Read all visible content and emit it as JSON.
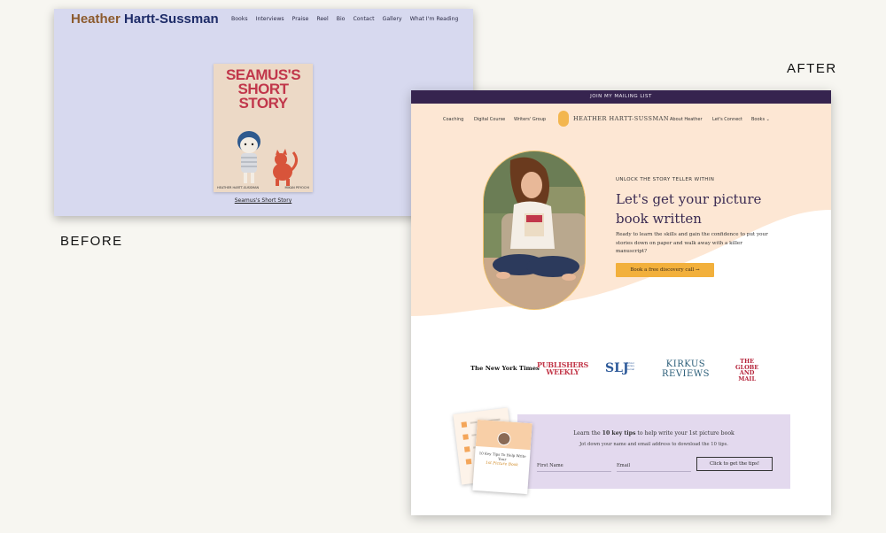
{
  "labels": {
    "before": "BEFORE",
    "after": "AFTER"
  },
  "before": {
    "logo_first": "Heather",
    "logo_last": "Hartt-Sussman",
    "nav": [
      "Books",
      "Interviews",
      "Praise",
      "Reel",
      "Bio",
      "Contact",
      "Gallery",
      "What I'm Reading"
    ],
    "book_title": "SEAMUS'S SHORT STORY",
    "book_authors": [
      "HEATHER HARTT-SUSSMAN",
      "MIKAN PEYOCHI"
    ],
    "caption": "Seamus's Short Story"
  },
  "after": {
    "topbar": "JOIN MY MAILING LIST",
    "nav_left": [
      "Coaching",
      "Digital Course",
      "Writers' Group"
    ],
    "logo": "HEATHER HARTT-SUSSMAN",
    "nav_right": [
      "About Heather",
      "Let's Connect",
      "Books"
    ],
    "eyebrow": "UNLOCK THE STORY TELLER WITHIN",
    "headline": "Let's get your picture book written",
    "subtext": "Ready to learn the skills and gain the confidence to put your stories down on paper and walk away with a killer manuscript?",
    "cta": "Book a free discovery call →",
    "press": {
      "nyt": "The New York Times",
      "pw_1": "PUBLISHERS",
      "pw_2": "WEEKLY",
      "slj": "SLJ",
      "slj_small": "School Library Journal",
      "kirkus_1": "KIRKUS",
      "kirkus_2": "REVIEWS",
      "globe_1": "THE",
      "globe_2": "GLOBE",
      "globe_3": "AND",
      "globe_4": "MAIL"
    },
    "optin": {
      "title_pre": "Learn the ",
      "title_bold": "10 key tips",
      "title_post": " to help write your 1st picture book",
      "sub": "Jot down your name and email address to download the 10 tips.",
      "first_name_placeholder": "First Name",
      "email_placeholder": "Email",
      "submit": "Click to get the tips!"
    },
    "booklet": {
      "line1": "10 Key Tips To Help Write Your",
      "line2": "1st Picture Book"
    },
    "colors": {
      "topbar": "#36244f",
      "hero": "#fde7d4",
      "accent": "#f2b03c",
      "optin": "#e3d9ee"
    }
  }
}
